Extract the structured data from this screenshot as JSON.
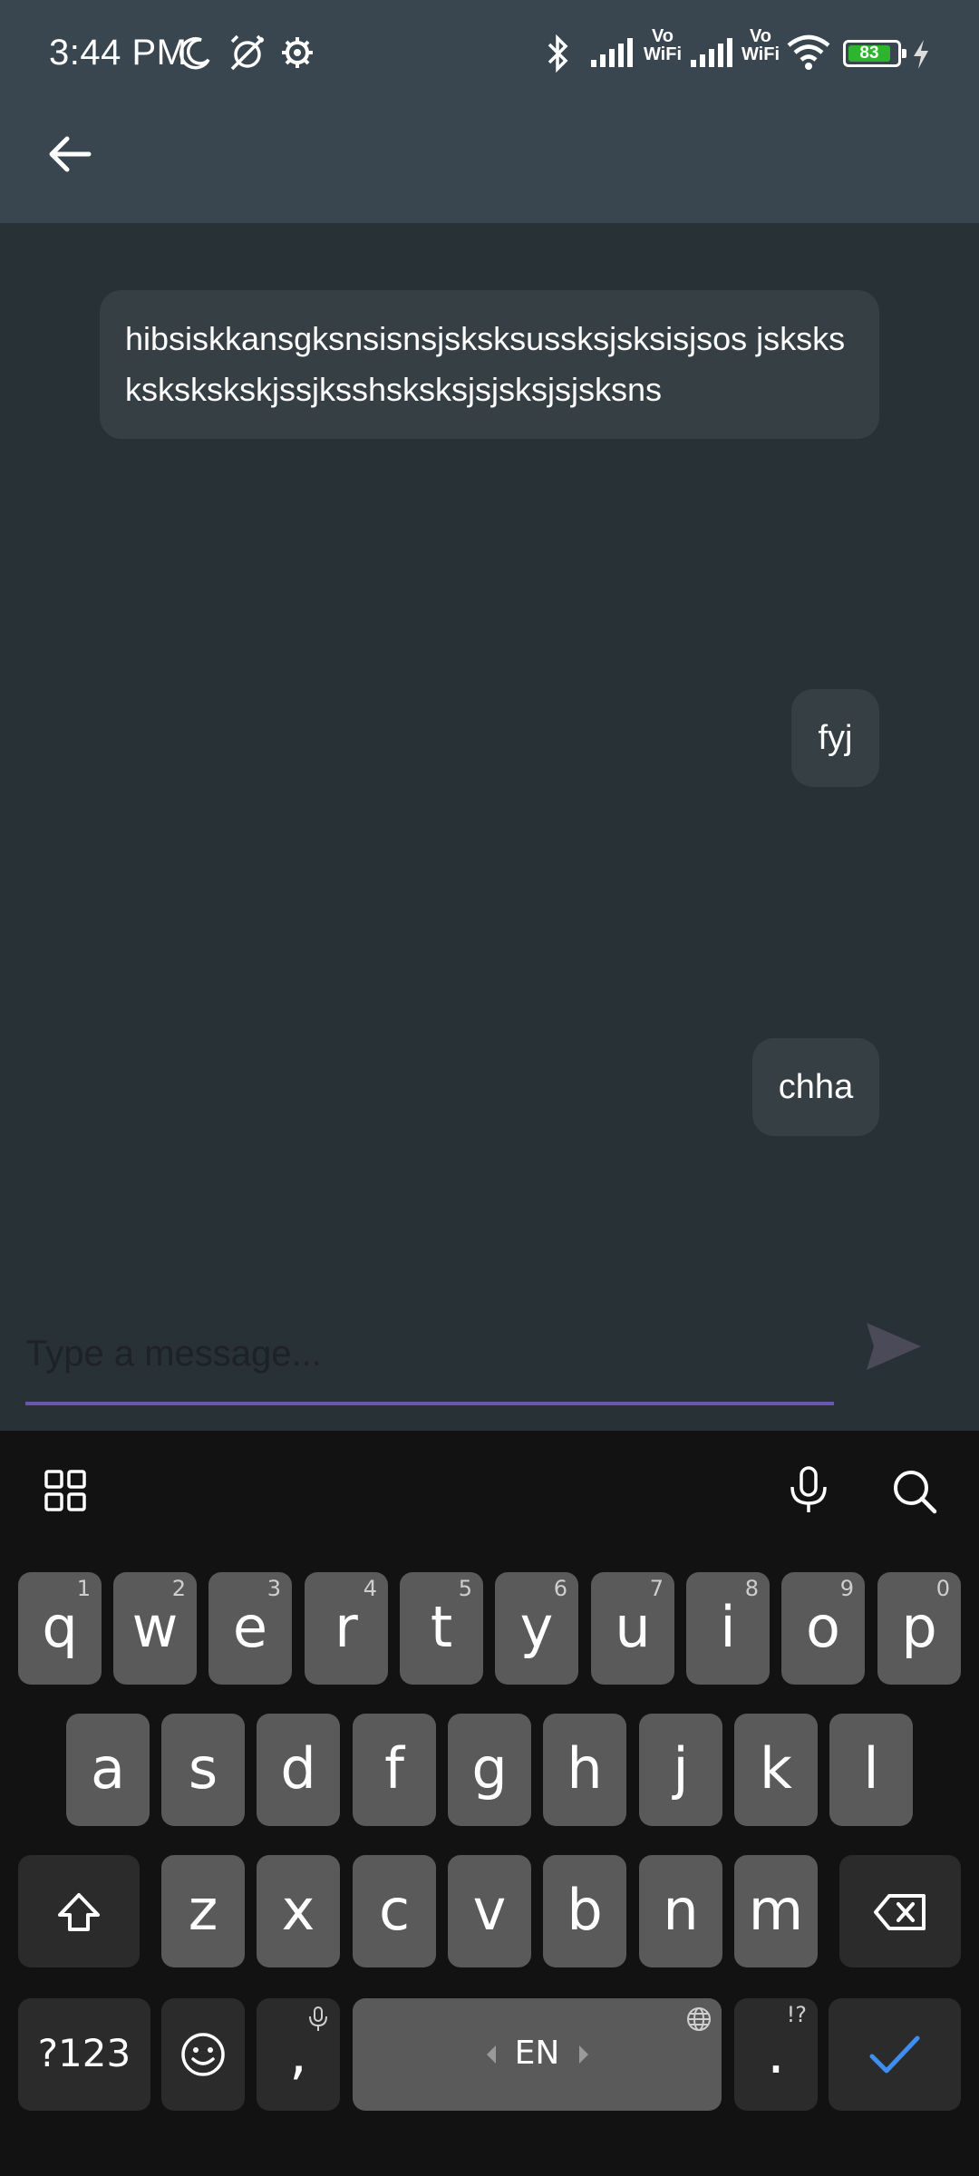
{
  "status_bar": {
    "time": "3:44 PM",
    "battery": "83",
    "icons": [
      "moon-icon",
      "alarm-off-icon",
      "settings-icon",
      "bluetooth-icon",
      "signal-icon",
      "vowifi-icon",
      "signal-icon",
      "vowifi-icon",
      "wifi-icon",
      "battery-icon",
      "charging-icon"
    ],
    "vowifi_label_1": "Vo",
    "vowifi_label_2": "WiFi"
  },
  "app_bar": {
    "back_icon": "arrow-left-icon"
  },
  "messages": [
    {
      "text": "hibsiskkansgksnsisnsjsksksussksjsksisjsos jskskskskskskskjssjksshsksksjsjsksjsjsksns"
    },
    {
      "text": "fyj"
    },
    {
      "text": "chha"
    }
  ],
  "composer": {
    "placeholder": "Type a message...",
    "value": "",
    "send_icon": "send-icon"
  },
  "keyboard": {
    "row1": [
      {
        "k": "q",
        "h": "1"
      },
      {
        "k": "w",
        "h": "2"
      },
      {
        "k": "e",
        "h": "3"
      },
      {
        "k": "r",
        "h": "4"
      },
      {
        "k": "t",
        "h": "5"
      },
      {
        "k": "y",
        "h": "6"
      },
      {
        "k": "u",
        "h": "7"
      },
      {
        "k": "i",
        "h": "8"
      },
      {
        "k": "o",
        "h": "9"
      },
      {
        "k": "p",
        "h": "0"
      }
    ],
    "row2": [
      "a",
      "s",
      "d",
      "f",
      "g",
      "h",
      "j",
      "k",
      "l"
    ],
    "row3": [
      "z",
      "x",
      "c",
      "v",
      "b",
      "n",
      "m"
    ],
    "symbols_label": "?123",
    "comma_label": ",",
    "space_label": "EN",
    "period_label": ".",
    "period_hint": "!?",
    "accent_color": "#3d8ef0"
  }
}
